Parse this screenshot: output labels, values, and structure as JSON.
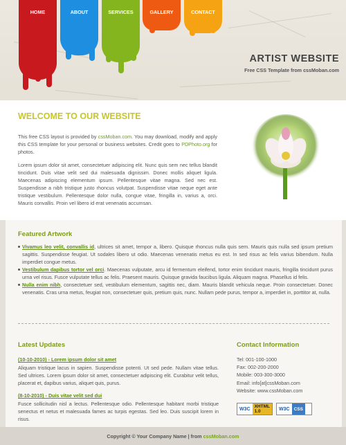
{
  "nav": [
    {
      "label": "HOME"
    },
    {
      "label": "ABOUT"
    },
    {
      "label": "SERVICES"
    },
    {
      "label": "GALLERY"
    },
    {
      "label": "CONTACT"
    }
  ],
  "header": {
    "title": "ARTIST WEBSITE",
    "tagline": "Free CSS Template from cssMoban.com"
  },
  "welcome": {
    "title": "WELCOME TO OUR WEBSITE",
    "p1_a": "This free CSS layout is provided by ",
    "p1_link1": "cssMoban.com",
    "p1_b": ". You may download, modify and apply this CSS template for your personal or business websites. Credit goes to ",
    "p1_link2": "PDPhoto.org",
    "p1_c": " for photos.",
    "p2": "Lorem ipsum dolor sit amet, consectetuer adipiscing elit. Nunc quis sem nec tellus blandit tincidunt. Duis vitae velit sed dui malesuada dignissim. Donec mollis aliquet ligula. Maecenas adipiscing elementum ipsum. Pellentesque vitae magna. Sed nec est. Suspendisse a nibh tristique justo rhoncus volutpat. Suspendisse vitae neque eget ante tristique vestibulum. Pellentesque dolor nulla, congue vitae, fringilla in, varius a, orci. Mauris convallis. Proin vel libero id erat venenatis accumsan."
  },
  "featured": {
    "title": "Featured Artwork",
    "items": [
      {
        "link": "Vivamus leo velit, convallis id",
        "text": ", ultrices sit amet, tempor a, libero. Quisque rhoncus nulla quis sem. Mauris quis nulla sed ipsum pretium sagittis. Suspendisse feugiat. Ut sodales libero ut odio. Maecenas venenatis metus eu est. In sed risus ac felis varius bibendum. Nulla imperdiet congue metus."
      },
      {
        "link": "Vestibulum dapibus tortor vel orci",
        "text": ". Maecenas vulputate, arcu id fermentum eleifend, tortor enim tincidunt mauris, fringilla tincidunt purus urna vel risus. Fusce vulputate tellus ac felis. Praesent mauris. Quisque gravida faucibus ligula. Aliquam magna. Phasellus id felis."
      },
      {
        "link": "Nulla enim nibh",
        "text": ", consectetuer sed, vestibulum elementum, sagittis nec, diam. Mauris blandit vehicula neque. Proin consectetuer. Donec venenatis. Cras urna metus, feugiat non, consectetuer quis, pretium quis, nunc. Nullam pede purus, tempor a, imperdiet in, porttitor at, nulla."
      }
    ]
  },
  "updates": {
    "title": "Latest Updates",
    "items": [
      {
        "date": "(10-10-2010) - Lorem ipsum dolor sit amet",
        "text": "Aliquam tristique lacus in sapien. Suspendisse potenti. Ut sed pede. Nullam vitae tellus. Sed ultrices. Lorem ipsum dolor sit amet, consectetuer adipiscing elit. Curabitur velit tellus, placerat et, dapibus varius, aliquet quis, purus."
      },
      {
        "date": "(8-10-2010) - Duis vitae velit sed dui",
        "text": "Fusce sollicitudin nisl a lectus. Pellentesque odio. Pellentesque habitant morbi tristique senectus et netus et malesuada fames ac turpis egestas. Sed leo. Duis suscipit lorem in risus."
      }
    ]
  },
  "contact": {
    "title": "Contact Information",
    "tel": "Tel: 001-100-1000",
    "fax": "Fax: 002-200-2000",
    "mobile": "Mobile: 003-300-3000",
    "email": "Email: info[at]cssMoban.com",
    "website": "Website: www.cssMoban.com"
  },
  "badges": {
    "w3c": "W3C",
    "xhtml": "XHTML",
    "xhtml_ver": "1.0",
    "css": "CSS"
  },
  "footer": {
    "text": "Copyright © Your Company Name | from ",
    "link": "cssMoban.com"
  },
  "colors": {
    "red": "#c8191f",
    "blue": "#1e8fe0",
    "green": "#84b51e",
    "orange": "#ef5a13",
    "yellow": "#f6a313",
    "accent_green": "#7d9a1f",
    "welcome_yellow": "#c7c62a"
  }
}
